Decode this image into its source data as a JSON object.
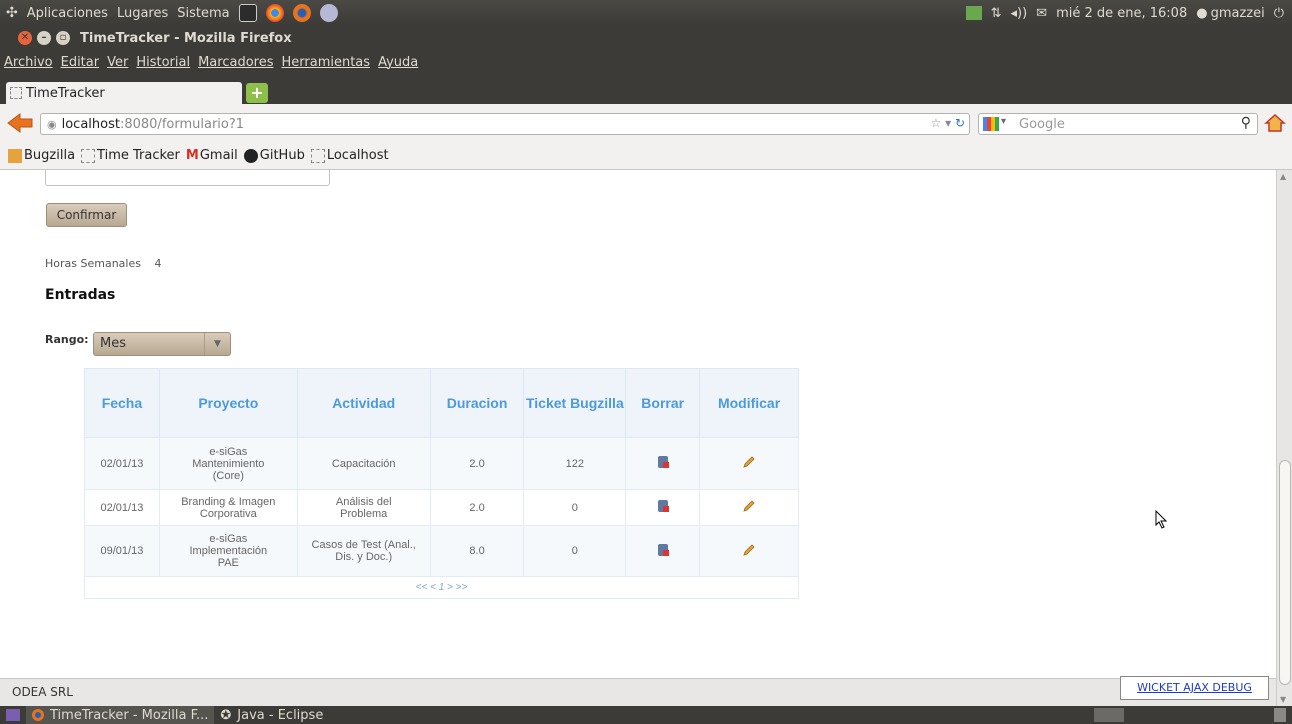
{
  "top_panel": {
    "menu": [
      "Aplicaciones",
      "Lugares",
      "Sistema"
    ],
    "clock": "mié 2 de ene, 16:08",
    "user": "gmazzei"
  },
  "window": {
    "title": "TimeTracker - Mozilla Firefox"
  },
  "menubar": [
    "Archivo",
    "Editar",
    "Ver",
    "Historial",
    "Marcadores",
    "Herramientas",
    "Ayuda"
  ],
  "tabs": [
    {
      "label": "TimeTracker"
    }
  ],
  "navbar": {
    "url_host": "localhost",
    "url_rest": ":8080/formulario?1",
    "search_placeholder": "Google"
  },
  "bookmarks": [
    "Bugzilla",
    "Time Tracker",
    "Gmail",
    "GitHub",
    "Localhost"
  ],
  "form": {
    "confirm_label": "Confirmar",
    "horas_label": "Horas Semanales",
    "horas_value": "4",
    "entradas_title": "Entradas",
    "rango_label": "Rango:",
    "rango_value": "Mes"
  },
  "table": {
    "headers": [
      "Fecha",
      "Proyecto",
      "Actividad",
      "Duracion",
      "Ticket Bugzilla",
      "Borrar",
      "Modificar"
    ],
    "rows": [
      {
        "fecha": "02/01/13",
        "proyecto": "e-siGas Mantenimiento (Core)",
        "actividad": "Capacitación",
        "duracion": "2.0",
        "ticket": "122"
      },
      {
        "fecha": "02/01/13",
        "proyecto": "Branding & Imagen Corporativa",
        "actividad": "Análisis del Problema",
        "duracion": "2.0",
        "ticket": "0"
      },
      {
        "fecha": "09/01/13",
        "proyecto": "e-siGas Implementación PAE",
        "actividad": "Casos de Test (Anal., Dis. y Doc.)",
        "duracion": "8.0",
        "ticket": "0"
      }
    ],
    "pager": "<< < 1 > >>"
  },
  "statusbar": {
    "company": "ODEA SRL",
    "wicket_debug": "WICKET AJAX DEBUG"
  },
  "taskbar": [
    {
      "label": "TimeTracker - Mozilla F..."
    },
    {
      "label": "Java - Eclipse"
    }
  ],
  "colors": {
    "header_text": "#4d9ad8",
    "panel_bg": "#3c3b37"
  }
}
